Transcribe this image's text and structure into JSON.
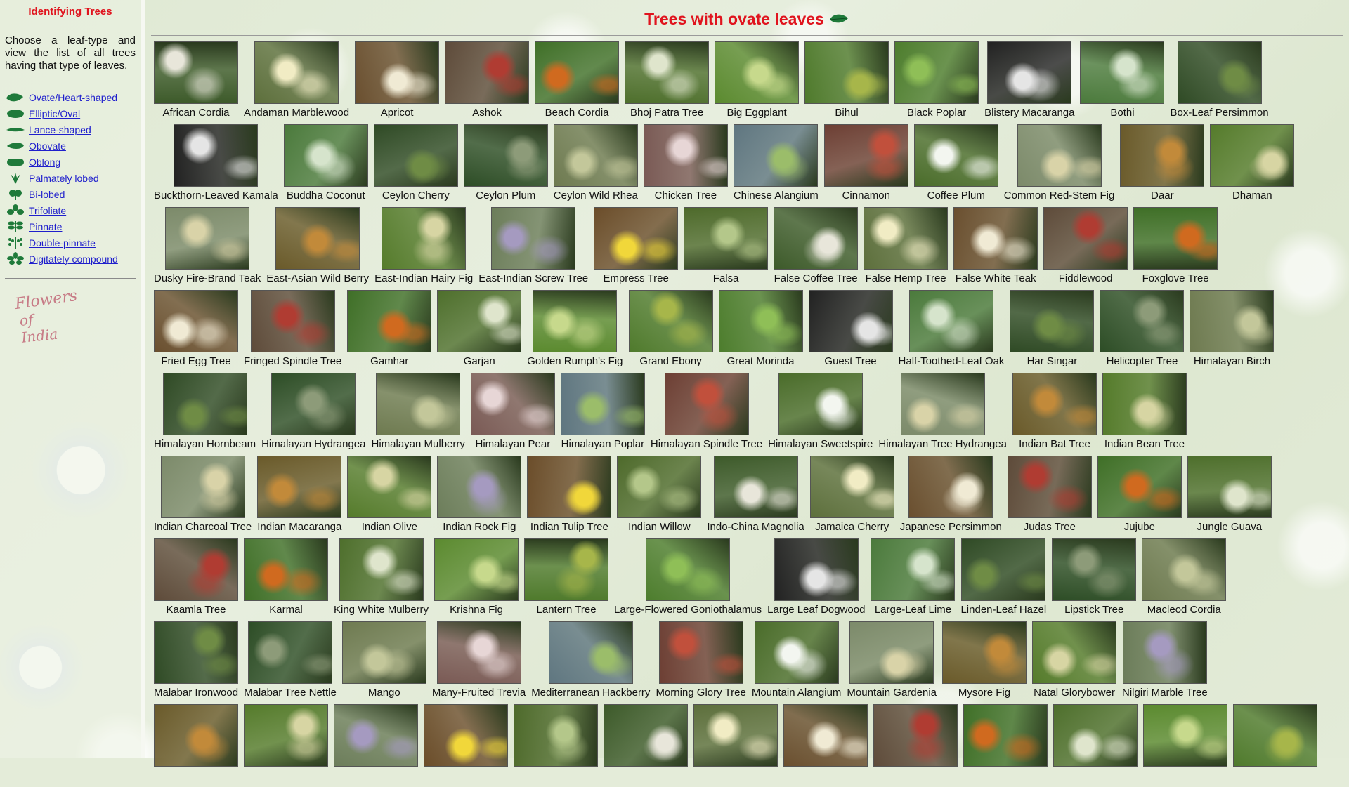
{
  "sidebar": {
    "title": "Identifying Trees",
    "intro": "Choose a leaf-type and view the list of all trees having that type of leaves.",
    "leaf_types": [
      {
        "label": "Ovate/Heart-shaped",
        "icon": "ovate-leaf-icon"
      },
      {
        "label": "Elliptic/Oval",
        "icon": "elliptic-leaf-icon"
      },
      {
        "label": "Lance-shaped",
        "icon": "lance-leaf-icon"
      },
      {
        "label": "Obovate",
        "icon": "obovate-leaf-icon"
      },
      {
        "label": "Oblong",
        "icon": "oblong-leaf-icon"
      },
      {
        "label": "Palmately lobed",
        "icon": "palmate-leaf-icon"
      },
      {
        "label": "Bi-lobed",
        "icon": "bilobed-leaf-icon"
      },
      {
        "label": "Trifoliate",
        "icon": "trifoliate-leaf-icon"
      },
      {
        "label": "Pinnate",
        "icon": "pinnate-leaf-icon"
      },
      {
        "label": "Double-pinnate",
        "icon": "double-pinnate-leaf-icon"
      },
      {
        "label": "Digitately compound",
        "icon": "digitate-leaf-icon"
      }
    ],
    "logo": {
      "line1": "Flowers",
      "line2": "of India"
    }
  },
  "header": {
    "title": "Trees with ovate leaves",
    "title_icon": "ovate-leaf-icon",
    "title_color": "#e0141e"
  },
  "colors": {
    "link": "#1f1fcc",
    "title_red": "#e0141e",
    "leaf_green": "#1f7a3a"
  },
  "rows": [
    [
      "African Cordia",
      "Andaman Marblewood",
      "Apricot",
      "Ashok",
      "Beach Cordia",
      "Bhoj Patra Tree",
      "Big Eggplant",
      "Bihul",
      "Black Poplar",
      "Blistery Macaranga",
      "Bothi",
      "Box-Leaf Persimmon"
    ],
    [
      "Buckthorn-Leaved Kamala",
      "Buddha Coconut",
      "Ceylon Cherry",
      "Ceylon Plum",
      "Ceylon Wild Rhea",
      "Chicken Tree",
      "Chinese Alangium",
      "Cinnamon",
      "Coffee Plum",
      "Common Red-Stem Fig",
      "Daar",
      "Dhaman"
    ],
    [
      "Dusky Fire-Brand Teak",
      "East-Asian Wild Berry",
      "East-Indian Hairy Fig",
      "East-Indian Screw Tree",
      "Empress Tree",
      "Falsa",
      "False Coffee Tree",
      "False Hemp Tree",
      "False White Teak",
      "Fiddlewood",
      "Foxglove Tree"
    ],
    [
      "Fried Egg Tree",
      "Fringed Spindle Tree",
      "Gamhar",
      "Garjan",
      "Golden Rumph's Fig",
      "Grand Ebony",
      "Great Morinda",
      "Guest Tree",
      "Half-Toothed-Leaf Oak",
      "Har Singar",
      "Helicopter Tree",
      "Himalayan Birch"
    ],
    [
      "Himalayan Hornbeam",
      "Himalayan Hydrangea",
      "Himalayan Mulberry",
      "Himalayan Pear",
      "Himalayan Poplar",
      "Himalayan Spindle Tree",
      "Himalayan Sweetspire",
      "Himalayan Tree Hydrangea",
      "Indian Bat Tree",
      "Indian Bean Tree"
    ],
    [
      "Indian Charcoal Tree",
      "Indian Macaranga",
      "Indian Olive",
      "Indian Rock Fig",
      "Indian Tulip Tree",
      "Indian Willow",
      "Indo-China Magnolia",
      "Jamaica Cherry",
      "Japanese Persimmon",
      "Judas Tree",
      "Jujube",
      "Jungle Guava"
    ],
    [
      "Kaamla Tree",
      "Karmal",
      "King White Mulberry",
      "Krishna Fig",
      "Lantern Tree",
      "Large-Flowered Goniothalamus",
      "Large Leaf Dogwood",
      "Large-Leaf Lime",
      "Linden-Leaf Hazel",
      "Lipstick Tree",
      "Macleod Cordia"
    ],
    [
      "Malabar Ironwood",
      "Malabar Tree Nettle",
      "Mango",
      "Many-Fruited Trevia",
      "Mediterranean Hackberry",
      "Morning Glory Tree",
      "Mountain Alangium",
      "Mountain Gardenia",
      "Mysore Fig",
      "Natal Glorybower",
      "Nilgiri Marble Tree"
    ],
    [
      "",
      "",
      "",
      "",
      "",
      "",
      "",
      "",
      "",
      "",
      "",
      "",
      ""
    ]
  ],
  "thumb_palettes": [
    [
      "#3d5a2a",
      "#e8e6da"
    ],
    [
      "#4f7a2c",
      "#a7b64a"
    ],
    [
      "#7a5a55",
      "#e7d6d6"
    ],
    [
      "#6c7d5a",
      "#a59ac0"
    ],
    [
      "#3f6f27",
      "#d06a1f"
    ],
    [
      "#2f4a25",
      "#6f8c45"
    ],
    [
      "#7c8a6a",
      "#d9d3a8"
    ],
    [
      "#5d6f3c",
      "#f1ecc4"
    ],
    [
      "#4d7d2d",
      "#8fbf57"
    ],
    [
      "#5f7680",
      "#9bbd6a"
    ],
    [
      "#6b4d2a",
      "#f1d73a"
    ],
    [
      "#4e6f2c",
      "#dfe5cc"
    ],
    [
      "#2d4d26",
      "#8d9b79"
    ],
    [
      "#6a5a2a",
      "#c28a3a"
    ],
    [
      "#6a4f2f",
      "#f0ead4"
    ],
    [
      "#222222",
      "#e5e5e5"
    ],
    [
      "#6d3f34",
      "#c1503c"
    ],
    [
      "#4e6a2b",
      "#b4c78a"
    ],
    [
      "#5b8a2f",
      "#c7d98c"
    ],
    [
      "#6e7a50",
      "#c3c79a"
    ],
    [
      "#557b2b",
      "#d7d5a3"
    ],
    [
      "#5e4b3a",
      "#b03c32"
    ],
    [
      "#4b7a3c",
      "#d6e4cc"
    ],
    [
      "#4a6c2a",
      "#f3f6f0"
    ]
  ]
}
